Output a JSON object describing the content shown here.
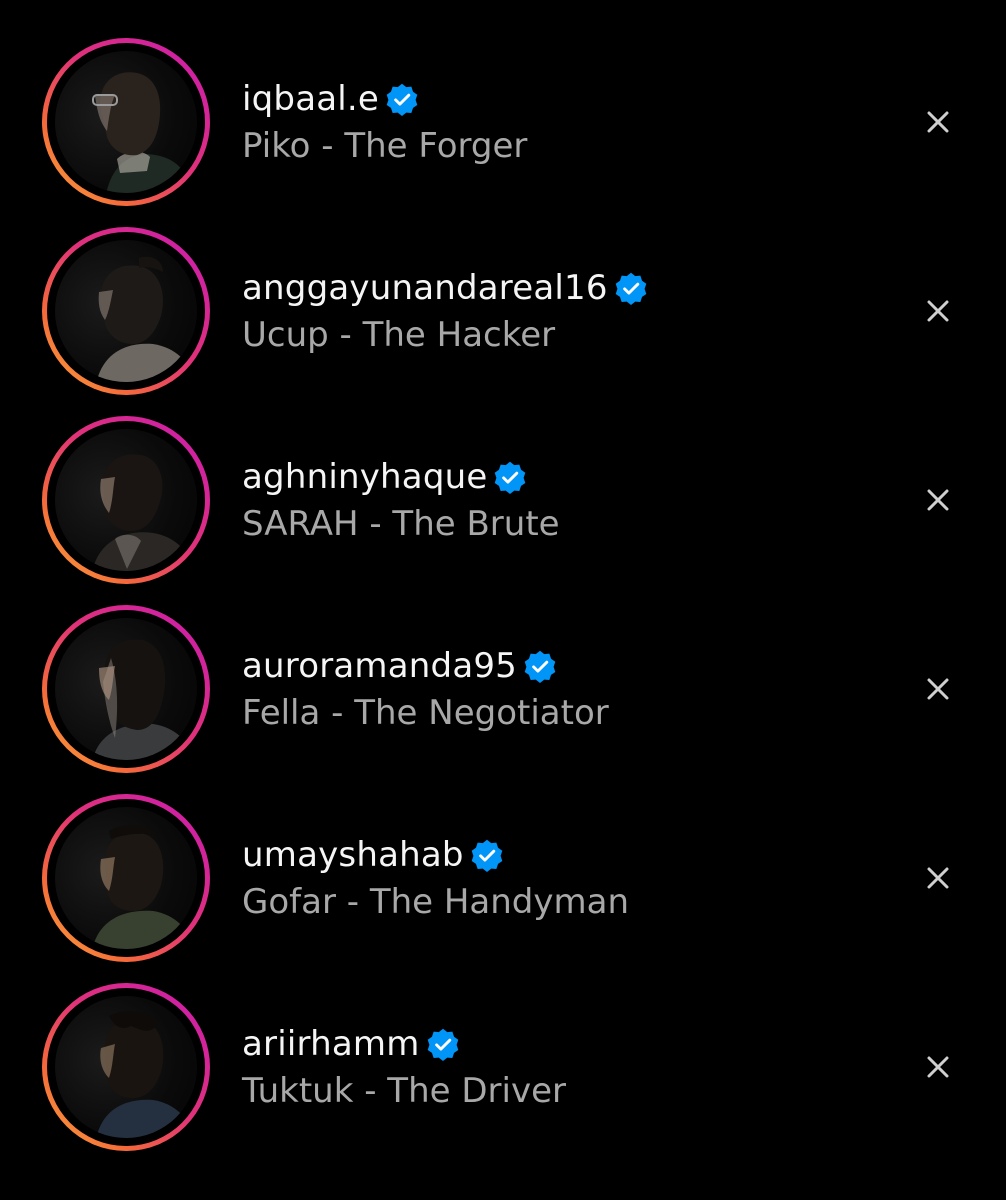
{
  "colors": {
    "background": "#000000",
    "username": "#f5f5f5",
    "subtitle": "#a8a8a8",
    "verified": "#0095f6",
    "close_icon": "#cfcfcf",
    "ring_gradient": [
      "#c81ab5",
      "#e0317a",
      "#f56a3a",
      "#fbb03b"
    ]
  },
  "accounts": [
    {
      "username": "iqbaal.e",
      "subtitle": "Piko - The Forger",
      "verified": true,
      "avatar_icon": "profile-photo",
      "dismiss_icon": "close-icon"
    },
    {
      "username": "anggayunandareal16",
      "subtitle": "Ucup - The Hacker",
      "verified": true,
      "avatar_icon": "profile-photo",
      "dismiss_icon": "close-icon"
    },
    {
      "username": "aghninyhaque",
      "subtitle": "SARAH - The Brute",
      "verified": true,
      "avatar_icon": "profile-photo",
      "dismiss_icon": "close-icon"
    },
    {
      "username": "auroramanda95",
      "subtitle": "Fella - The Negotiator",
      "verified": true,
      "avatar_icon": "profile-photo",
      "dismiss_icon": "close-icon"
    },
    {
      "username": "umayshahab",
      "subtitle": "Gofar - The Handyman",
      "verified": true,
      "avatar_icon": "profile-photo",
      "dismiss_icon": "close-icon"
    },
    {
      "username": "ariirhamm",
      "subtitle": "Tuktuk - The Driver",
      "verified": true,
      "avatar_icon": "profile-photo",
      "dismiss_icon": "close-icon"
    }
  ]
}
